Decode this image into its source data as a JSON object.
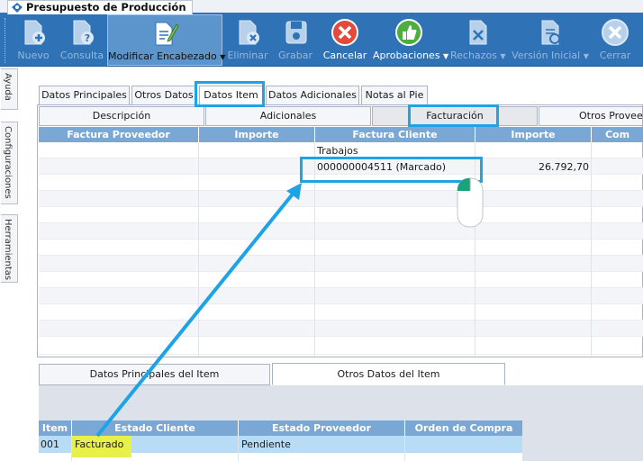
{
  "window": {
    "title": "Presupuesto de Producción"
  },
  "toolbar": {
    "buttons": [
      {
        "label": "Nuevo",
        "icon": "new-document-icon",
        "enabled": false
      },
      {
        "label": "Consulta",
        "icon": "query-document-icon",
        "enabled": false
      },
      {
        "label": "Modificar Encabezado",
        "icon": "edit-document-icon",
        "enabled": true,
        "has_dropdown": true
      },
      {
        "label": "Eliminar",
        "icon": "delete-document-icon",
        "enabled": false
      },
      {
        "label": "Grabar",
        "icon": "save-icon",
        "enabled": false
      },
      {
        "label": "Cancelar",
        "icon": "cancel-icon",
        "enabled": true
      },
      {
        "label": "Aprobaciones",
        "icon": "thumbs-up-icon",
        "enabled": true,
        "has_dropdown": true
      },
      {
        "label": "Rechazos",
        "icon": "reject-document-icon",
        "enabled": false,
        "has_dropdown": true
      },
      {
        "label": "Versión Inicial",
        "icon": "version-document-icon",
        "enabled": false,
        "has_dropdown": true
      },
      {
        "label": "Cerrar",
        "icon": "close-icon",
        "enabled": false
      }
    ]
  },
  "side_tabs": [
    "Ayuda",
    "Configuraciones",
    "Herramientas"
  ],
  "main_tabs": [
    "Datos Principales",
    "Otros Datos",
    "Datos Item",
    "Datos Adicionales",
    "Notas al Pie"
  ],
  "main_tabs_selected": "Datos Item",
  "sub_tabs": [
    "Descripción",
    "Adicionales",
    "Facturación",
    "Otros Proveed"
  ],
  "sub_tabs_selected": "Facturación",
  "billing_grid": {
    "columns": [
      "Factura Proveedor",
      "Importe",
      "Factura Cliente",
      "Importe",
      "Com"
    ],
    "group_label": "Trabajos",
    "rows": [
      {
        "factura_proveedor": "",
        "importe": "",
        "factura_cliente": "000000004511 (Marcado)",
        "importe_cliente": "26.792,70",
        "com": ""
      }
    ]
  },
  "bottom_tabs": [
    "Datos Principales del Item",
    "Otros Datos del Item"
  ],
  "bottom_tabs_selected": "Otros Datos del Item",
  "item_grid": {
    "columns": [
      "Item",
      "Estado Cliente",
      "Estado Proveedor",
      "Orden de Compra"
    ],
    "rows": [
      {
        "item": "001",
        "estado_cliente": "Facturado",
        "estado_proveedor": "Pendiente",
        "orden_compra": ""
      }
    ]
  },
  "colors": {
    "ribbon": "#2f73b6",
    "grid_header": "#7ba7d4",
    "highlight": "#1ea3e6",
    "selected_row": "#b8dcf5",
    "marker": "#e8f04a"
  }
}
